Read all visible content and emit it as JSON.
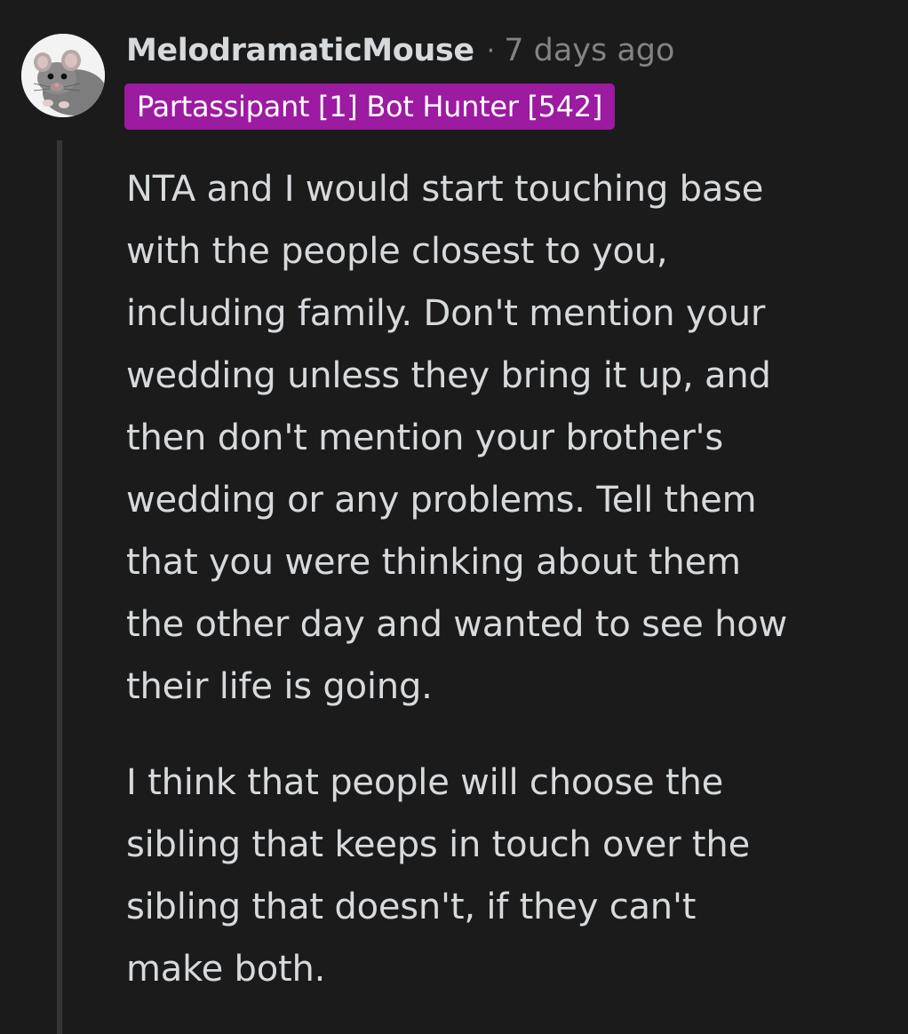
{
  "comment": {
    "username": "MelodramaticMouse",
    "separator": "·",
    "timestamp": "7 days ago",
    "flair": "Partassipant [1] Bot Hunter [542]",
    "avatar_icon": "rat-avatar-icon",
    "flair_color": "#9c1ba1",
    "paragraphs": [
      {
        "lines": [
          "NTA and I would start touching base",
          "with the people closest to you,",
          "including family. Don't mention your",
          "wedding unless they bring it up, and",
          "then don't mention your brother's",
          "wedding or any problems. Tell them",
          "that you were thinking about them",
          "the other day and wanted to see how",
          "their life is going."
        ]
      },
      {
        "lines": [
          "I think that people will choose the",
          "sibling that keeps in touch over the",
          "sibling that doesn't, if they can't",
          "make both."
        ]
      }
    ]
  }
}
